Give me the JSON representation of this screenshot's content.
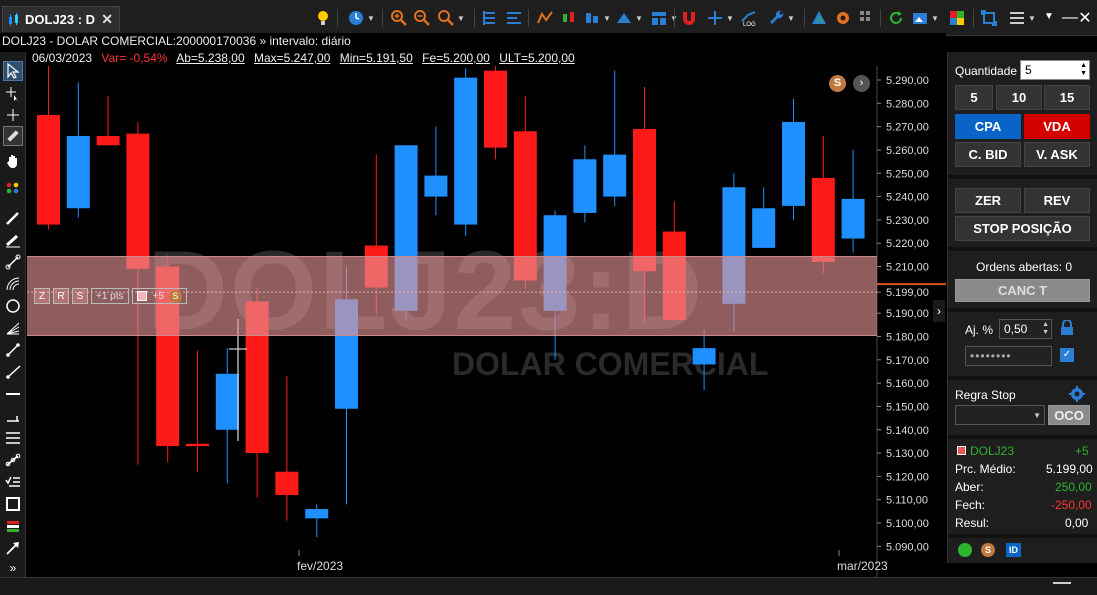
{
  "tab": {
    "title": "DOLJ23 : D"
  },
  "info": {
    "line": "DOLJ23 - DOLAR COMERCIAL:200000170036 » intervalo: diário"
  },
  "ohlc": {
    "date": "06/03/2023",
    "var": "Var= -0,54%",
    "ab": "Ab=5.238,00",
    "max": "Max=5.247,00",
    "min": "Min=5.191,50",
    "fe": "Fe=5.200,00",
    "ult": "ULT=5.200,00"
  },
  "watermark": {
    "symbol": "DOLJ23:D",
    "name": "DOLAR COMERCIAL"
  },
  "position_bar": {
    "z": "Z",
    "r": "R",
    "s": "S",
    "pts": "+1 pts",
    "qty": "+5",
    "badge": "S"
  },
  "chart_badge": "S",
  "chart_data": {
    "type": "candlestick",
    "y_ticks": [
      "5.290,00",
      "5.280,00",
      "5.270,00",
      "5.260,00",
      "5.250,00",
      "5.240,00",
      "5.230,00",
      "5.220,00",
      "5.210,00",
      "5.199,00",
      "5.190,00",
      "5.180,00",
      "5.170,00",
      "5.160,00",
      "5.150,00",
      "5.140,00",
      "5.130,00",
      "5.120,00",
      "5.110,00",
      "5.100,00",
      "5.090,00"
    ],
    "current_price": "5.199,00",
    "x_labels": [
      "fev/2023",
      "mar/2023"
    ],
    "ylim": [
      5088,
      5296
    ],
    "candles": [
      {
        "o": 5275,
        "h": 5300,
        "l": 5226,
        "c": 5228,
        "col": "down"
      },
      {
        "o": 5235,
        "h": 5289,
        "l": 5231,
        "c": 5266,
        "col": "up"
      },
      {
        "o": 5266,
        "h": 5283,
        "l": 5262,
        "c": 5262,
        "col": "down"
      },
      {
        "o": 5267,
        "h": 5272,
        "l": 5125,
        "c": 5209,
        "col": "down"
      },
      {
        "o": 5210,
        "h": 5215,
        "l": 5126,
        "c": 5133,
        "col": "down"
      },
      {
        "o": 5134,
        "h": 5174,
        "l": 5122,
        "c": 5133,
        "col": "down"
      },
      {
        "o": 5140,
        "h": 5175,
        "l": 5117,
        "c": 5164,
        "col": "up"
      },
      {
        "o": 5195,
        "h": 5201,
        "l": 5111,
        "c": 5130,
        "col": "down"
      },
      {
        "o": 5122,
        "h": 5163,
        "l": 5101,
        "c": 5112,
        "col": "down"
      },
      {
        "o": 5102,
        "h": 5108,
        "l": 5094,
        "c": 5106,
        "col": "up"
      },
      {
        "o": 5149,
        "h": 5210,
        "l": 5108,
        "c": 5196,
        "col": "up"
      },
      {
        "o": 5201,
        "h": 5258,
        "l": 5189,
        "c": 5219,
        "col": "down"
      },
      {
        "o": 5191,
        "h": 5262,
        "l": 5187,
        "c": 5262,
        "col": "up"
      },
      {
        "o": 5240,
        "h": 5270,
        "l": 5232,
        "c": 5249,
        "col": "up"
      },
      {
        "o": 5228,
        "h": 5295,
        "l": 5223,
        "c": 5291,
        "col": "up"
      },
      {
        "o": 5294,
        "h": 5296,
        "l": 5256,
        "c": 5261,
        "col": "down"
      },
      {
        "o": 5268,
        "h": 5283,
        "l": 5200,
        "c": 5204,
        "col": "down"
      },
      {
        "o": 5191,
        "h": 5234,
        "l": 5170,
        "c": 5232,
        "col": "up"
      },
      {
        "o": 5233,
        "h": 5262,
        "l": 5229,
        "c": 5256,
        "col": "up"
      },
      {
        "o": 5240,
        "h": 5294,
        "l": 5236,
        "c": 5258,
        "col": "up"
      },
      {
        "o": 5269,
        "h": 5287,
        "l": 5185,
        "c": 5208,
        "col": "down"
      },
      {
        "o": 5225,
        "h": 5238,
        "l": 5197,
        "c": 5187,
        "col": "down"
      },
      {
        "o": 5168,
        "h": 5183,
        "l": 5157,
        "c": 5175,
        "col": "up"
      },
      {
        "o": 5194,
        "h": 5250,
        "l": 5182,
        "c": 5244,
        "col": "up"
      },
      {
        "o": 5218,
        "h": 5244,
        "l": 5218,
        "c": 5235,
        "col": "up"
      },
      {
        "o": 5236,
        "h": 5282,
        "l": 5230,
        "c": 5272,
        "col": "up"
      },
      {
        "o": 5248,
        "h": 5266,
        "l": 5207,
        "c": 5212,
        "col": "down"
      },
      {
        "o": 5222,
        "h": 5260,
        "l": 5216,
        "c": 5239,
        "col": "up"
      }
    ]
  },
  "panel": {
    "qty_label": "Quantidade",
    "qty_value": "5",
    "q5": "5",
    "q10": "10",
    "q15": "15",
    "buy": "CPA",
    "sell": "VDA",
    "cbid": "C. BID",
    "vask": "V. ASK",
    "zer": "ZER",
    "rev": "REV",
    "stop": "STOP POSIÇÃO",
    "orders": "Ordens abertas: 0",
    "canc": "CANC T",
    "aj_label": "Aj. %",
    "aj_value": "0,50",
    "password": "••••••••",
    "rule_label": "Regra Stop",
    "oco": "OCO",
    "symbol": "DOLJ23",
    "pos_qty": "+5",
    "pm_label": "Prc. Médio:",
    "pm_value": "5.199,00",
    "aber_label": "Aber:",
    "aber_value": "250,00",
    "fech_label": "Fech:",
    "fech_value": "-250,00",
    "resul_label": "Resul:",
    "resul_value": "0,00",
    "badge_s": "S",
    "badge_id": "ID"
  },
  "colors": {
    "up": "#1e90ff",
    "down": "#ff1a1a",
    "buy": "#0a64c8",
    "sell": "#d40000",
    "green": "#2fb32f"
  }
}
